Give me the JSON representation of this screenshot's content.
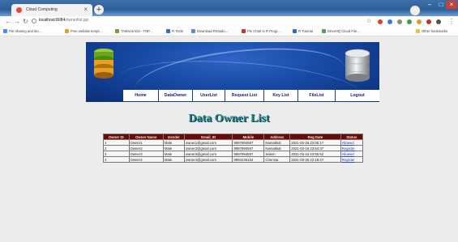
{
  "browser": {
    "tab_title": "Cloud Computing",
    "url_host": "localhost:8084",
    "url_path": "/ownerlist.jsp",
    "bookmarks": [
      {
        "label": "File sharing and sto...",
        "color": "#4a90d9"
      },
      {
        "label": "Free website templ...",
        "color": "#e0a030"
      },
      {
        "label": "TAMILNADU - TNP...",
        "color": "#7a9a3a"
      },
      {
        "label": "R Tools",
        "color": "#3a6ab8"
      },
      {
        "label": "Download RStudio...",
        "color": "#5a8ad0"
      },
      {
        "label": "Pie Chart in R Progr...",
        "color": "#c0392b"
      },
      {
        "label": "R Tutorial",
        "color": "#2a70c0"
      },
      {
        "label": "DriveHQ Cloud File...",
        "color": "#5a9a5a"
      }
    ],
    "other_bookmarks": "Other bookmarks"
  },
  "menu": [
    {
      "label": "Home",
      "width": 44
    },
    {
      "label": "DataOwner",
      "width": 42
    },
    {
      "label": "UserList",
      "width": 40
    },
    {
      "label": "Request List",
      "width": 48
    },
    {
      "label": "Key List",
      "width": 42
    },
    {
      "label": "FileList",
      "width": 46
    },
    {
      "label": "Logout",
      "width": 54
    }
  ],
  "page": {
    "title": "Data Owner List"
  },
  "table": {
    "columns": [
      "Owner ID",
      "Owner Name",
      "Gender",
      "Email_ID",
      "Mobile",
      "Address",
      "Reg Date",
      "Status"
    ],
    "rows": [
      [
        "1",
        "Owner1",
        "Male",
        "owner1@gmail.com",
        "9987894567",
        "Namakkal",
        "2021-02-26 22:05:17",
        "Allowed"
      ],
      [
        "2",
        "Owner2",
        "Male",
        "owner2@gmail.com",
        "9987894567",
        "Namakkal",
        "2021-03-16 23:54:37",
        "Register"
      ],
      [
        "3",
        "Owner3",
        "Male",
        "owner3@gmail.com",
        "9987894567",
        "Salem",
        "2021-03-16 23:55:52",
        "Allowed"
      ],
      [
        "4",
        "Owner4",
        "Male",
        "owner4@gmail.com",
        "8994246154",
        "Chennai",
        "2021-03-25 22:19:27",
        "Register"
      ]
    ]
  }
}
